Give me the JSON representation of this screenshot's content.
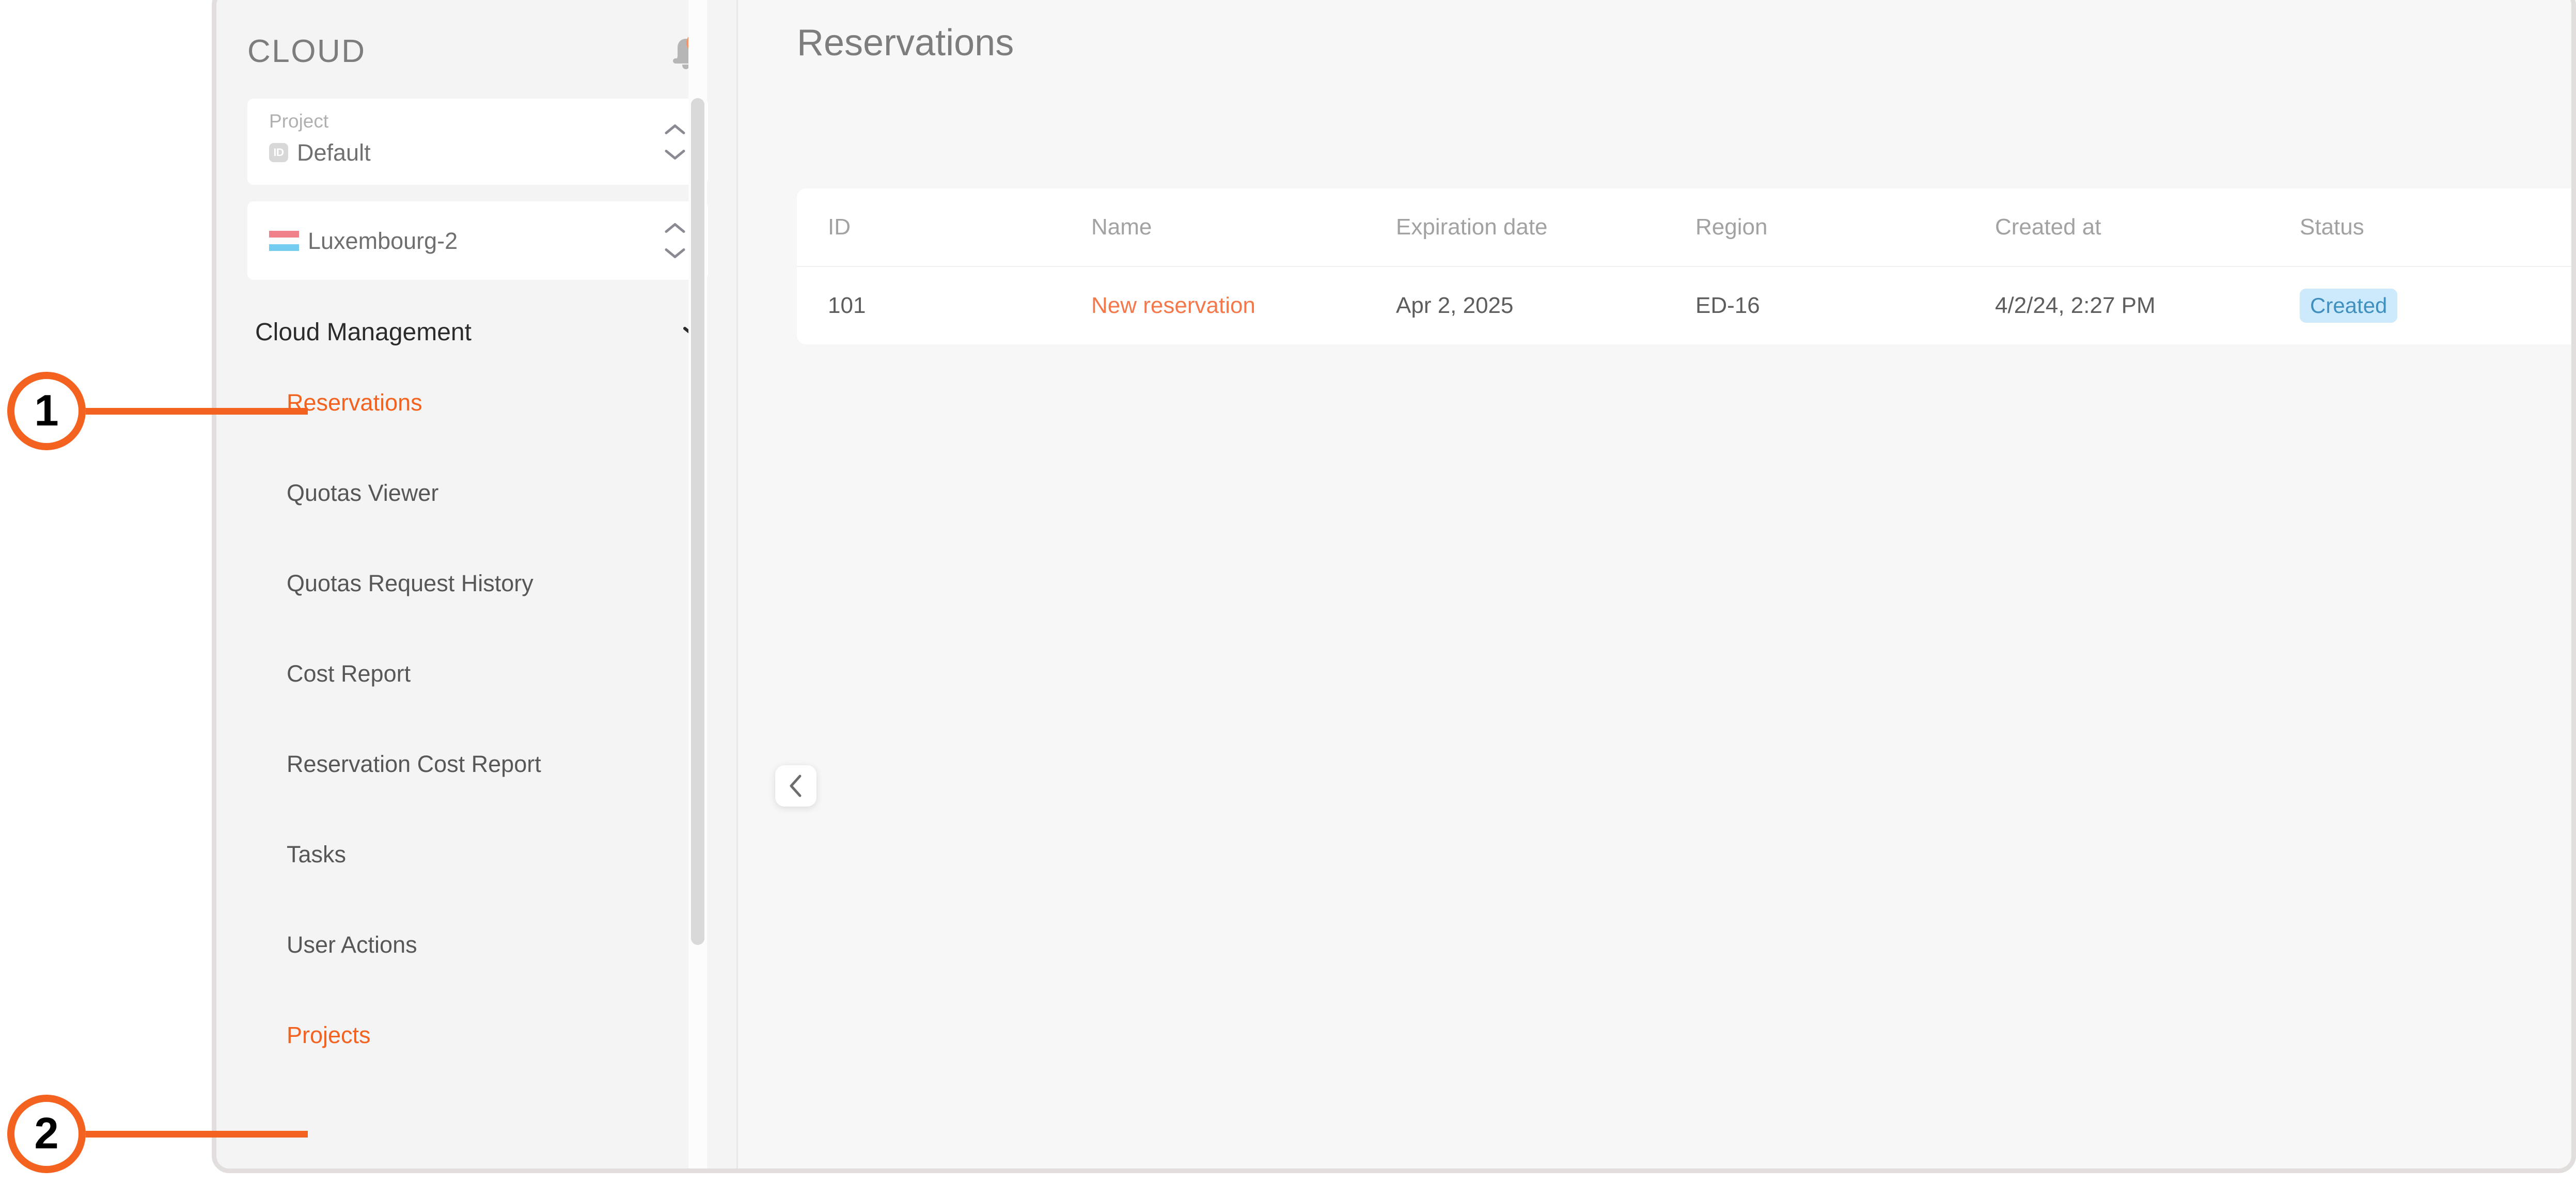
{
  "sidebar": {
    "brand": "CLOUD",
    "bell_icon": "bell-icon",
    "project_selector": {
      "label": "Project",
      "badge": "ID",
      "value": "Default"
    },
    "region_selector": {
      "flag": "luxembourg-flag",
      "value": "Luxembourg-2"
    },
    "nav_group": {
      "title": "Cloud Management",
      "chevron": "chevron-down-icon"
    },
    "nav_items": [
      {
        "label": "Reservations",
        "active": true
      },
      {
        "label": "Quotas Viewer",
        "active": false
      },
      {
        "label": "Quotas Request History",
        "active": false
      },
      {
        "label": "Cost Report",
        "active": false
      },
      {
        "label": "Reservation Cost Report",
        "active": false
      },
      {
        "label": "Tasks",
        "active": false
      },
      {
        "label": "User Actions",
        "active": false
      },
      {
        "label": "Projects",
        "active": true
      }
    ],
    "collapse_icon": "chevron-left-icon"
  },
  "main": {
    "title": "Reservations",
    "table": {
      "columns": [
        "ID",
        "Name",
        "Expiration date",
        "Region",
        "Created at",
        "Status"
      ],
      "rows": [
        {
          "id": "101",
          "name": "New reservation",
          "expiration_date": "Apr 2, 2025",
          "region": "ED-16",
          "created_at": "4/2/24, 2:27 PM",
          "status": "Created"
        }
      ]
    }
  },
  "callouts": [
    {
      "number": "1"
    },
    {
      "number": "2"
    }
  ],
  "colors": {
    "accent": "#f4621f",
    "link": "#f4784a",
    "status_badge_bg": "#cdeafc",
    "status_badge_text": "#3f8fbf",
    "notification_dot": "#fa9367"
  }
}
